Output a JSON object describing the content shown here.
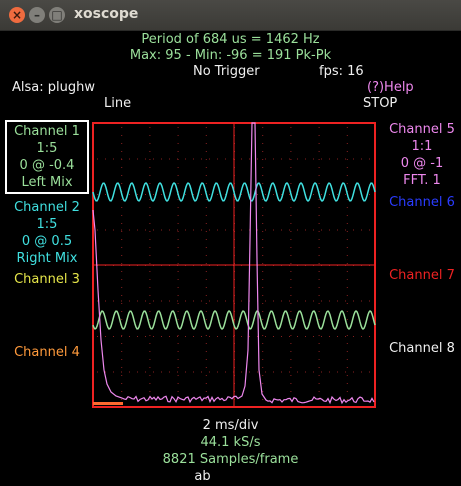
{
  "window": {
    "title": "xoscope",
    "close_glyph": "×",
    "minimize_glyph": "–",
    "maximize_glyph": "□"
  },
  "header": {
    "period_line": "Period of    684 us =   1462 Hz",
    "maxmin_line": "Max: 95 - Min: -96 = 191 Pk-Pk",
    "trigger": "No Trigger",
    "fps": "fps: 16",
    "source": "Alsa: plughw",
    "help": "(?)Help",
    "mode": "Line",
    "run_state": "STOP"
  },
  "channels_left": [
    {
      "label": "Channel 1",
      "scale": "1:5",
      "position": "0 @ -0.4",
      "source": "Left Mix",
      "color": "#9be09b"
    },
    {
      "label": "Channel 2",
      "scale": "1:5",
      "position": "0 @ 0.5",
      "source": "Right Mix",
      "color": "#40e0e0"
    },
    {
      "label": "Channel 3",
      "color": "#e6e64a"
    },
    {
      "label": "Channel 4",
      "color": "#ff9a3c"
    }
  ],
  "channels_right": [
    {
      "label": "Channel 5",
      "scale": "1:1",
      "position": "0 @ -1",
      "source": "FFT. 1",
      "color": "#ee88ee"
    },
    {
      "label": "Channel 6",
      "color": "#2a3cff"
    },
    {
      "label": "Channel 7",
      "color": "#ee2222"
    },
    {
      "label": "Channel 8",
      "color": "#f0f0f0"
    }
  ],
  "footer": {
    "timebase": "2 ms/div",
    "sample_rate": "44.1 kS/s",
    "samples": "8821 Samples/frame",
    "marker": "ab"
  },
  "scope": {
    "grid_color": "#ee2222",
    "ch1_wave_color": "#9be09b",
    "ch2_wave_color": "#40e0e0",
    "fft_color": "#ee88ee",
    "cycles_visible": 20
  }
}
